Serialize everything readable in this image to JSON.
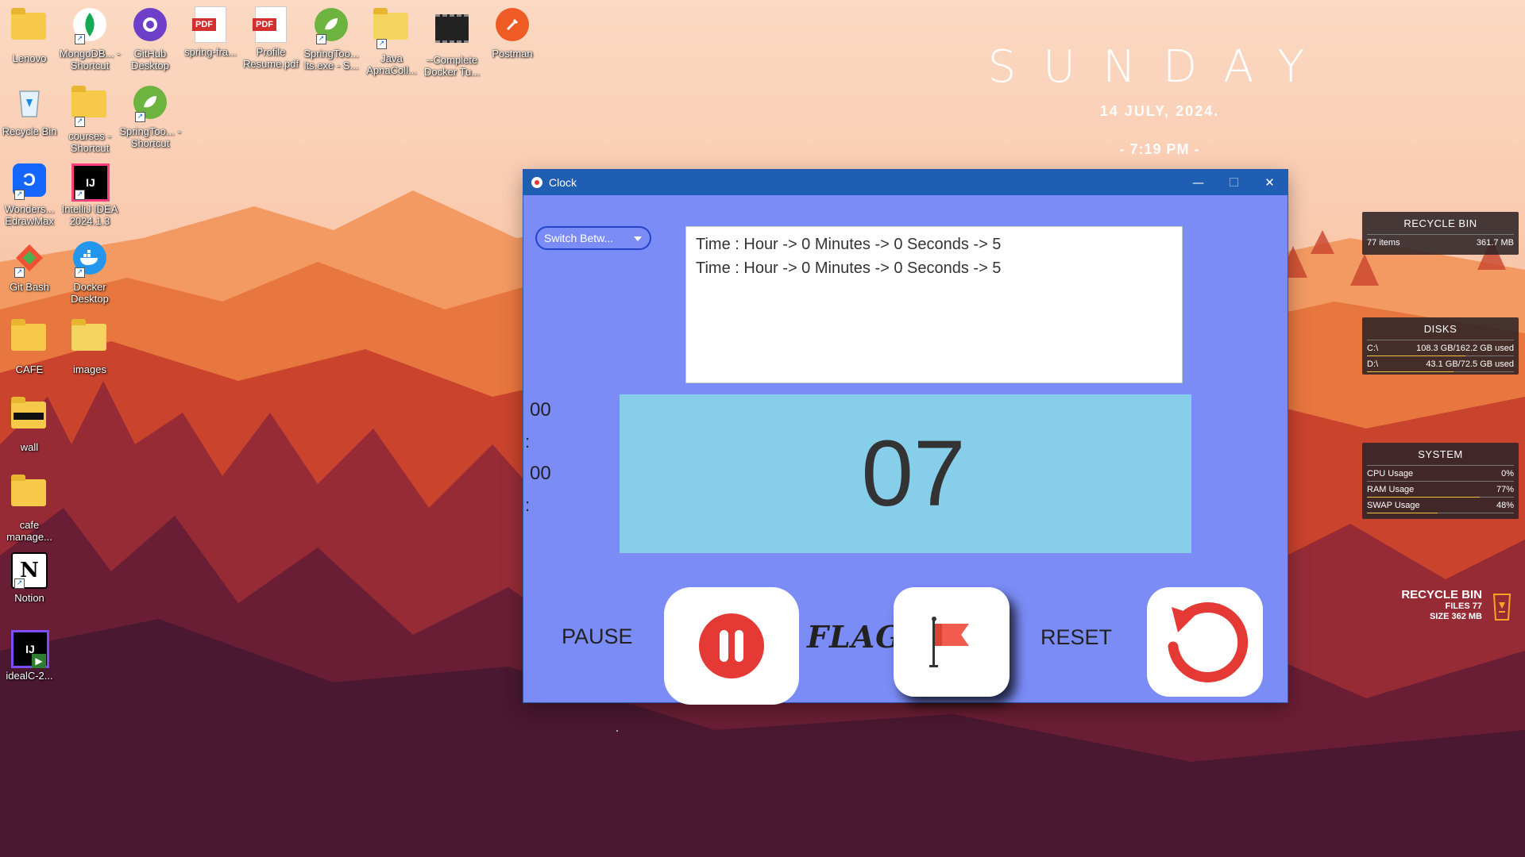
{
  "desktop": {
    "icons": [
      {
        "label": "Lenovo"
      },
      {
        "label": "MongoDB... - Shortcut"
      },
      {
        "label": "GitHub Desktop"
      },
      {
        "label": "spring-fra..."
      },
      {
        "label": "Profile Resume.pdf"
      },
      {
        "label": "SpringToo... lts.exe - S..."
      },
      {
        "label": "Java ApnaColl..."
      },
      {
        "label": "--Complete Docker Tu..."
      },
      {
        "label": "Postman"
      },
      {
        "label": "Recycle Bin"
      },
      {
        "label": "courses - Shortcut"
      },
      {
        "label": "SpringToo... - Shortcut"
      },
      {
        "label": "Wonders... EdrawMax"
      },
      {
        "label": "IntelliJ IDEA 2024.1.3"
      },
      {
        "label": "Git Bash"
      },
      {
        "label": "Docker Desktop"
      },
      {
        "label": "CAFE"
      },
      {
        "label": "images"
      },
      {
        "label": "wall"
      },
      {
        "label": "cafe manage..."
      },
      {
        "label": "Notion"
      },
      {
        "label": "idealC-2..."
      }
    ],
    "icon_names": [
      "folder-icon",
      "mongodb-icon",
      "github-icon",
      "pdf-icon",
      "pdf-icon",
      "spring-icon",
      "folder-icon",
      "video-icon",
      "postman-icon",
      "recycle-bin-icon",
      "folder-icon",
      "spring-icon",
      "edrawmax-icon",
      "intellij-icon",
      "git-bash-icon",
      "docker-icon",
      "folder-icon",
      "folder-icon",
      "folder-icon",
      "folder-icon",
      "notion-icon",
      "intellij-installer-icon"
    ],
    "pdf_badge": "PDF",
    "ij_badge": "IJ",
    "notion_badge": "N"
  },
  "date_widget": {
    "day": "SUNDAY",
    "date": "14 JULY, 2024.",
    "time": "- 7:19 PM -"
  },
  "widgets": {
    "recycle_bin": {
      "title": "RECYCLE BIN",
      "items": "77 items",
      "size": "361.7 MB"
    },
    "disks": {
      "title": "DISKS",
      "rows": [
        {
          "name": "C:\\",
          "value": "108.3 GB/162.2 GB used",
          "fraction": 0.67
        },
        {
          "name": "D:\\",
          "value": "43.1 GB/72.5 GB used",
          "fraction": 0.59
        }
      ]
    },
    "system": {
      "title": "SYSTEM",
      "rows": [
        {
          "name": "CPU Usage",
          "value": "0%",
          "fraction": 0.0
        },
        {
          "name": "RAM Usage",
          "value": "77%",
          "fraction": 0.77
        },
        {
          "name": "SWAP Usage",
          "value": "48%",
          "fraction": 0.48
        }
      ]
    },
    "recycle_bin_big": {
      "title": "RECYCLE BIN",
      "files": "FILES 77",
      "size": "SIZE 362 MB"
    }
  },
  "clock_app": {
    "title": "Clock",
    "controls": {
      "minimize": "—",
      "maximize": "☐",
      "close": "✕"
    },
    "mode_select": {
      "value": "Switch Betw..."
    },
    "laps": [
      "Time : Hour -> 0 Minutes -> 0 Seconds -> 5",
      "Time : Hour -> 0 Minutes -> 0 Seconds -> 5"
    ],
    "hours": "00",
    "minutes": "00",
    "colon": ":",
    "seconds": "07",
    "pause_label": "PAUSE",
    "flag_label": "FLAG",
    "reset_label": "RESET",
    "colors": {
      "window_bg": "#7b8cf7",
      "display_bg": "#87ceeb",
      "titlebar": "#1e5fb4",
      "accent_red": "#e53935"
    }
  }
}
